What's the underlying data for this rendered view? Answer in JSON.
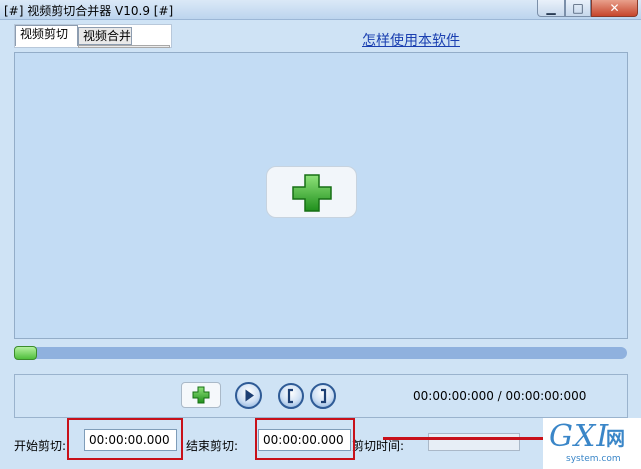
{
  "window": {
    "title": "[#] 视频剪切合并器 V10.9 [#]",
    "controls": {
      "minimize": "▁",
      "maximize": "□",
      "close": "✕"
    }
  },
  "tabs": [
    {
      "label": "视频剪切",
      "active": true
    },
    {
      "label": "视频合并",
      "active": false
    }
  ],
  "help_link": "怎样使用本软件",
  "player": {
    "progress": 0.0,
    "time_display": "00:00:00:000 / 00:00:00:000",
    "icons": {
      "add_video": "plus-icon",
      "play": "play-icon",
      "mark_in": "bracket-left-icon",
      "mark_out": "bracket-right-icon"
    }
  },
  "cut": {
    "start_label": "开始剪切:",
    "start_value": "00:00:00.000",
    "end_label": "结束剪切:",
    "end_value": "00:00:00.000",
    "duration_label": "剪切时间:",
    "duration_value": ""
  },
  "watermark": {
    "brand": "GXI",
    "brand_suffix": "网",
    "domain": "system.com"
  },
  "colors": {
    "background": "#cfe3f5",
    "highlight_red": "#c8111a",
    "plus_green": "#2fae2a",
    "link_blue": "#1a3fb0"
  }
}
